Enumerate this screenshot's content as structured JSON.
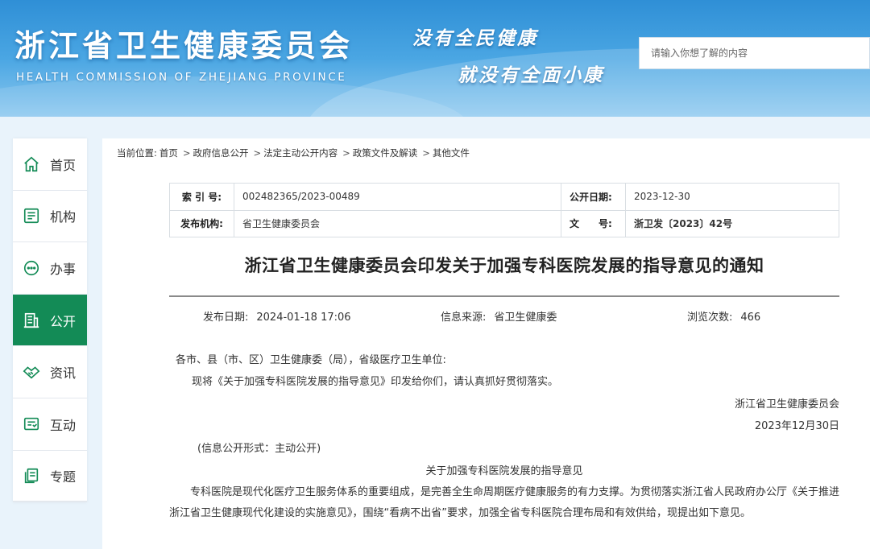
{
  "header": {
    "title": "浙江省卫生健康委员会",
    "subtitle": "HEALTH COMMISSION OF ZHEJIANG PROVINCE",
    "slogan_line1": "没有全民健康",
    "slogan_line2": "就没有全面小康",
    "search_placeholder": "请输入你想了解的内容"
  },
  "sidebar": {
    "items": [
      {
        "label": "首页",
        "icon": "home-icon"
      },
      {
        "label": "机构",
        "icon": "document-icon"
      },
      {
        "label": "办事",
        "icon": "chat-icon"
      },
      {
        "label": "公开",
        "icon": "building-icon",
        "active": true
      },
      {
        "label": "资讯",
        "icon": "handshake-icon"
      },
      {
        "label": "互动",
        "icon": "feedback-icon"
      },
      {
        "label": "专题",
        "icon": "pages-icon"
      }
    ],
    "active_color": "#138b56"
  },
  "breadcrumb": {
    "prefix": "当前位置:",
    "items": [
      "首页",
      "政府信息公开",
      "法定主动公开内容",
      "政策文件及解读",
      "其他文件"
    ],
    "separator": ">"
  },
  "info_table": {
    "index_label": "索 引 号:",
    "index_value": "002482365/2023-00489",
    "pubdate_label": "公开日期:",
    "pubdate_value": "2023-12-30",
    "org_label": "发布机构:",
    "org_value": "省卫生健康委员会",
    "docno_label": "文　　号:",
    "docno_value": "浙卫发〔2023〕42号"
  },
  "document": {
    "title": "浙江省卫生健康委员会印发关于加强专科医院发展的指导意见的通知",
    "meta": {
      "date_label": "发布日期:",
      "date_value": "2024-01-18 17:06",
      "source_label": "信息来源:",
      "source_value": "省卫生健康委",
      "views_label": "浏览次数:",
      "views_value": "466"
    },
    "salutation": "各市、县（市、区）卫生健康委（局），省级医疗卫生单位:",
    "intro": "现将《关于加强专科医院发展的指导意见》印发给你们，请认真抓好贯彻落实。",
    "signature": "浙江省卫生健康委员会",
    "sign_date": "2023年12月30日",
    "disclosure": "(信息公开形式：主动公开)",
    "subtitle": "关于加强专科医院发展的指导意见",
    "paragraph": "专科医院是现代化医疗卫生服务体系的重要组成，是完善全生命周期医疗健康服务的有力支撑。为贯彻落实浙江省人民政府办公厅《关于推进浙江省卫生健康现代化建设的实施意见》，围绕“看病不出省”要求，加强全省专科医院合理布局和有效供给，现提出如下意见。"
  }
}
